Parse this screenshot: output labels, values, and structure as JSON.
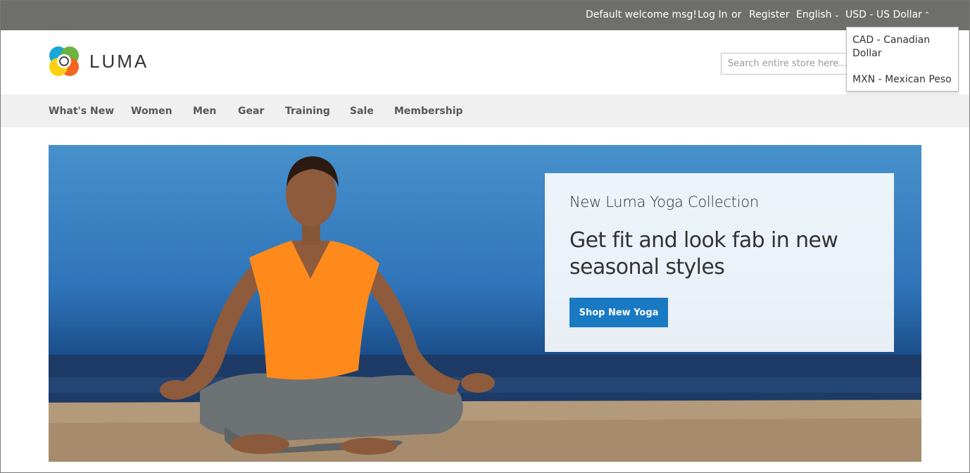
{
  "header_panel": {
    "welcome": "Default welcome msg!",
    "login": "Log In",
    "or": "or",
    "register": "Register",
    "language": "English",
    "currency": "USD - US Dollar"
  },
  "currency_dropdown": {
    "options": [
      "CAD - Canadian Dollar",
      "MXN - Mexican Peso"
    ]
  },
  "logo": {
    "text": "LUMA"
  },
  "search": {
    "placeholder": "Search entire store here..."
  },
  "nav": {
    "items": [
      "What's New",
      "Women",
      "Men",
      "Gear",
      "Training",
      "Sale",
      "Membership"
    ]
  },
  "hero": {
    "subtitle": "New Luma Yoga Collection",
    "title": "Get fit and look fab in new seasonal styles",
    "button": "Shop New Yoga"
  },
  "colors": {
    "panel_bg": "#6e6e6b",
    "nav_bg": "#f0f0f0",
    "accent_button": "#1979c3"
  }
}
